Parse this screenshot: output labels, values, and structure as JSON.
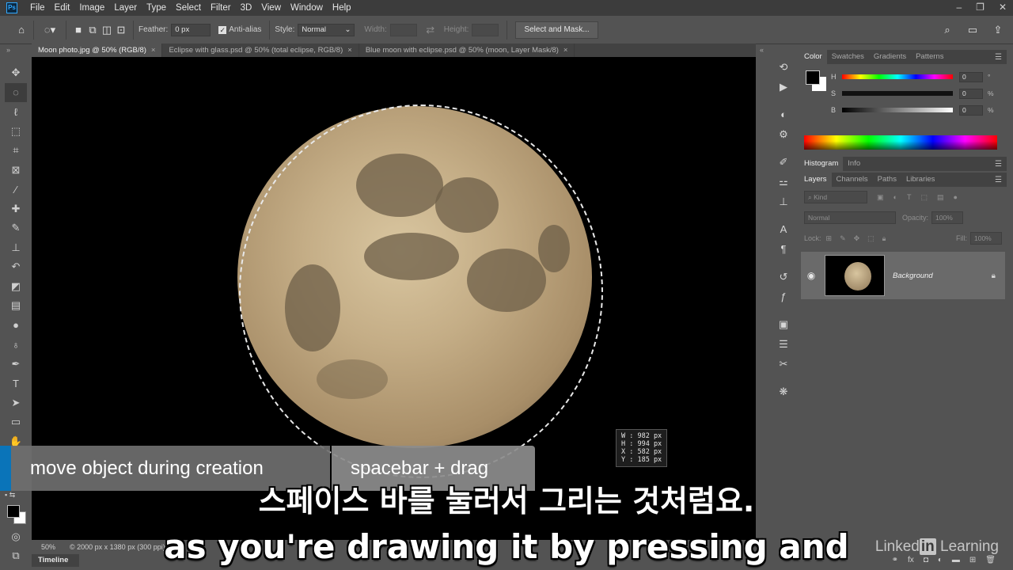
{
  "app": {
    "logo": "Ps"
  },
  "menubar": {
    "items": [
      "File",
      "Edit",
      "Image",
      "Layer",
      "Type",
      "Select",
      "Filter",
      "3D",
      "View",
      "Window",
      "Help"
    ]
  },
  "options": {
    "feather_label": "Feather:",
    "feather_value": "0 px",
    "antialias_label": "Anti-alias",
    "style_label": "Style:",
    "style_value": "Normal",
    "width_label": "Width:",
    "height_label": "Height:",
    "select_mask_label": "Select and Mask..."
  },
  "tabs": [
    {
      "label": "Moon photo.jpg @ 50% (RGB/8)",
      "active": true
    },
    {
      "label": "Eclipse with glass.psd @ 50% (total eclipse, RGB/8)",
      "active": false
    },
    {
      "label": "Blue moon with eclipse.psd @ 50% (moon, Layer Mask/8)",
      "active": false
    }
  ],
  "readout": {
    "w": "W : 982 px",
    "h": "H : 994 px",
    "x": "X : 582 px",
    "y": "Y : 185 px"
  },
  "status": {
    "zoom": "50%",
    "doc_size": "2000 px x 1380 px (300 ppi)"
  },
  "timeline_label": "Timeline",
  "color_panel": {
    "tabs": [
      "Color",
      "Swatches",
      "Gradients",
      "Patterns"
    ],
    "h_label": "H",
    "s_label": "S",
    "b_label": "B",
    "h_value": "0",
    "s_value": "0",
    "b_value": "0",
    "h_unit": "°",
    "s_unit": "%",
    "b_unit": "%"
  },
  "histogram_tabs": [
    "Histogram",
    "Info"
  ],
  "layers_panel": {
    "tabs": [
      "Layers",
      "Channels",
      "Paths",
      "Libraries"
    ],
    "kind_placeholder": "Kind",
    "blend_mode": "Normal",
    "opacity_label": "Opacity:",
    "opacity_value": "100%",
    "lock_label": "Lock:",
    "fill_label": "Fill:",
    "fill_value": "100%",
    "layer_name": "Background"
  },
  "overlay": {
    "action": "move object during creation",
    "shortcut": "spacebar + drag",
    "subtitle_ko": "스페이스 바를 눌러서 그리는 것처럼요.",
    "subtitle_en": "as you're drawing it by pressing and"
  },
  "watermark": {
    "linked": "Linked",
    "in": "in",
    "learning": " Learning"
  }
}
